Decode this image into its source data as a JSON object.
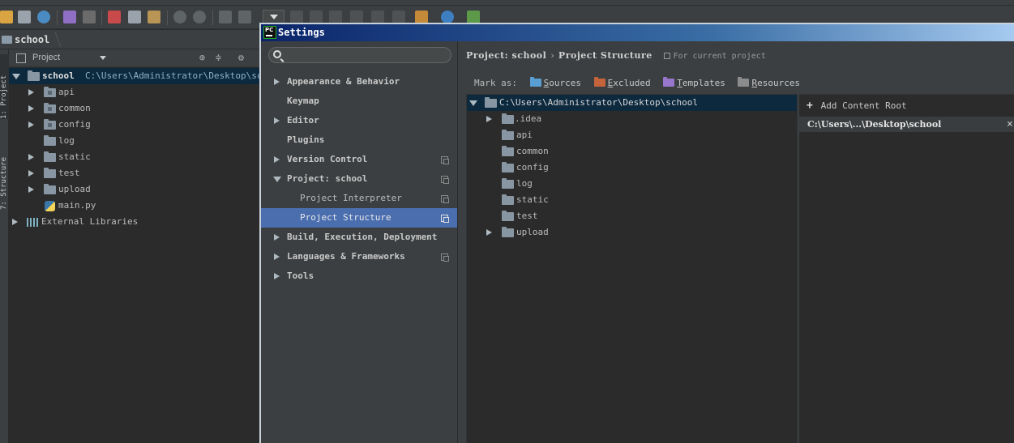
{
  "navbar": {
    "crumb": "school"
  },
  "side_tabs": [
    "1: Project",
    "7: Structure"
  ],
  "project_panel": {
    "view_label": "Project",
    "tree": [
      {
        "label": "school",
        "path": "C:\\Users\\Administrator\\Desktop\\school",
        "expanded": true,
        "selected": true
      },
      {
        "label": "api",
        "has_children": true
      },
      {
        "label": "common",
        "has_children": true
      },
      {
        "label": "config",
        "has_children": true
      },
      {
        "label": "log",
        "has_children": false
      },
      {
        "label": "static",
        "has_children": true
      },
      {
        "label": "test",
        "has_children": true
      },
      {
        "label": "upload",
        "has_children": true
      },
      {
        "label": "main.py",
        "file": true
      },
      {
        "label": "External Libraries",
        "has_children": true
      }
    ]
  },
  "dialog": {
    "title": "Settings",
    "title_icon_text": "PC",
    "search": {
      "placeholder": "",
      "value": ""
    },
    "nav": [
      {
        "label": "Appearance & Behavior",
        "expandable": true,
        "copy": false
      },
      {
        "label": "Keymap",
        "expandable": false,
        "copy": false
      },
      {
        "label": "Editor",
        "expandable": true,
        "copy": false
      },
      {
        "label": "Plugins",
        "expandable": false,
        "copy": false
      },
      {
        "label": "Version Control",
        "expandable": true,
        "copy": true
      },
      {
        "label": "Project: school",
        "expandable": true,
        "expanded": true,
        "copy": true
      },
      {
        "label": "Project Interpreter",
        "sub": true,
        "copy": true
      },
      {
        "label": "Project Structure",
        "sub": true,
        "copy": true,
        "selected": true
      },
      {
        "label": "Build, Execution, Deployment",
        "expandable": true,
        "copy": false
      },
      {
        "label": "Languages & Frameworks",
        "expandable": true,
        "copy": true
      },
      {
        "label": "Tools",
        "expandable": true,
        "copy": false
      }
    ],
    "breadcrumb": {
      "part1": "Project: school",
      "separator": "›",
      "part2": "Project Structure",
      "scope": "For current project"
    },
    "mark_as": {
      "label": "Mark as:",
      "buttons": [
        {
          "label": "Sources",
          "color": "#5a9fd4"
        },
        {
          "label": "Excluded",
          "color": "#c5643b"
        },
        {
          "label": "Templates",
          "color": "#9876cc"
        },
        {
          "label": "Resources",
          "color": "#8c8c8c"
        }
      ]
    },
    "content_tree": [
      {
        "label": "C:\\Users\\Administrator\\Desktop\\school",
        "expanded": true,
        "selected": true
      },
      {
        "label": ".idea",
        "has_children": true
      },
      {
        "label": "api"
      },
      {
        "label": "common"
      },
      {
        "label": "config"
      },
      {
        "label": "log"
      },
      {
        "label": "static"
      },
      {
        "label": "test"
      },
      {
        "label": "upload",
        "has_children": true
      }
    ],
    "content_roots": {
      "add_label": "Add Content Root",
      "add_mnemonic": "C",
      "root_path": "C:\\Users\\...\\Desktop\\school",
      "close_glyph": "×"
    }
  }
}
